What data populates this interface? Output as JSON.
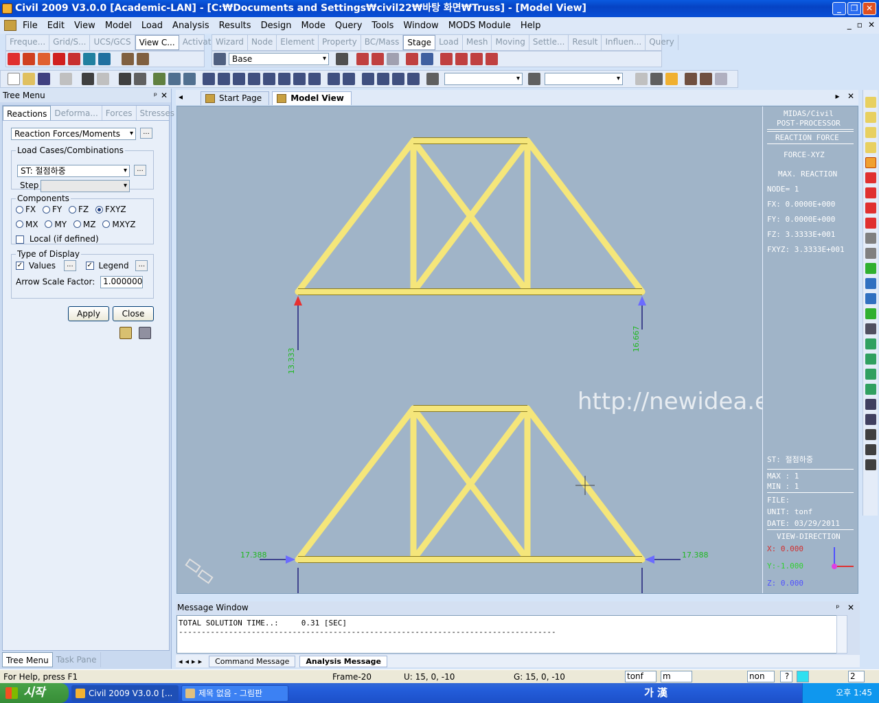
{
  "window": {
    "title": "Civil 2009 V3.0.0 [Academic-LAN] - [C:₩Documents and Settings₩civil22₩바탕 화면₩Truss] - [Model View]",
    "buttons": [
      "_",
      "❐",
      "✕"
    ]
  },
  "menu": {
    "items": [
      "File",
      "Edit",
      "View",
      "Model",
      "Load",
      "Analysis",
      "Results",
      "Design",
      "Mode",
      "Query",
      "Tools",
      "Window",
      "MODS Module",
      "Help"
    ],
    "mdi_controls": [
      "_",
      "▫",
      "✕"
    ]
  },
  "toolbar_left_tabs": [
    "Freque...",
    "Grid/S...",
    "UCS/GCS",
    "View C...",
    "Activat..."
  ],
  "toolbar_left_active": 3,
  "toolbar_right_tabs": [
    "Wizard",
    "Node",
    "Element",
    "Property",
    "BC/Mass",
    "Stage",
    "Load",
    "Mesh",
    "Moving",
    "Settle...",
    "Result",
    "Influen...",
    "Query"
  ],
  "toolbar_right_active": 5,
  "stage_combo": "Base",
  "tree_menu": {
    "title": "Tree Menu",
    "pin": "ᵖ",
    "close": "✕",
    "tabs": [
      "Reactions",
      "Deforma...",
      "Forces",
      "Stresses"
    ],
    "active_tab": 0,
    "result_type": "Reaction Forces/Moments",
    "load_cases_label": "Load Cases/Combinations",
    "load_case": "ST: 절점하중",
    "step_label": "Step",
    "components_label": "Components",
    "components_row1": [
      "FX",
      "FY",
      "FZ",
      "FXYZ"
    ],
    "components_row2": [
      "MX",
      "MY",
      "MZ",
      "MXYZ"
    ],
    "selected_component": "FXYZ",
    "local_label": "Local (if defined)",
    "display_label": "Type of Display",
    "values_label": "Values",
    "legend_label": "Legend",
    "arrow_scale_label": "Arrow Scale Factor:",
    "arrow_scale_value": "1.000000",
    "apply": "Apply",
    "close_btn": "Close",
    "ellipsis": "...",
    "bottom_tabs": [
      "Tree Menu",
      "Task Pane"
    ],
    "bottom_active": 0
  },
  "doc_tabs": [
    "Start Page",
    "Model View"
  ],
  "doc_active": 1,
  "viewport": {
    "reactions_top": [
      "13.333",
      "16.667"
    ],
    "reactions_bottom": [
      "17.388",
      "17.388"
    ],
    "watermark": "http://newidea.egloos.com/"
  },
  "side_info": {
    "header1": "MIDAS/Civil",
    "header2": "POST-PROCESSOR",
    "result": "REACTION FORCE",
    "component": "FORCE-XYZ",
    "max_reaction": "MAX. REACTION",
    "node": "NODE= 1",
    "fx": "FX:   0.0000E+000",
    "fy": "FY:   0.0000E+000",
    "fz": "FZ:   3.3333E+001",
    "fxyz": "FXYZ: 3.3333E+001",
    "load_case": "ST: 절점하중",
    "max": "MAX : 1",
    "min": "MIN : 1",
    "file": "FILE:",
    "unit": "UNIT: tonf",
    "date": "DATE: 03/29/2011",
    "view_dir": "VIEW-DIRECTION",
    "vx": "X: 0.000",
    "vy": "Y:-1.000",
    "vz": "Z: 0.000",
    "colors": {
      "x": "#d23030",
      "y": "#30d030",
      "z": "#5050ff"
    }
  },
  "message_window": {
    "title": "Message Window",
    "line1": "TOTAL SOLUTION TIME..:     0.31 [SEC]",
    "line2": "-----------------------------------------------------------------------------------",
    "tabs": [
      "Command Message",
      "Analysis Message"
    ],
    "active_tab": 1
  },
  "status": {
    "help": "For Help, press F1",
    "frame": "Frame-20",
    "u": "U: 15, 0, -10",
    "g": "G: 15, 0, -10",
    "force_unit": "tonf",
    "length_unit": "m",
    "snap": "non",
    "page": "2"
  },
  "taskbar": {
    "start": "시작",
    "tasks": [
      "Civil 2009 V3.0.0 [...",
      "제목 없음 - 그림판"
    ],
    "ime": "가 漢",
    "clock": "오후 1:45"
  },
  "colors": {
    "member": "#f5e67a",
    "member_edge": "#8a7a20",
    "viewport_bg": "#a0b4c8",
    "support_arrow": "#6b6bff",
    "max_arrow": "#e83030",
    "value_text": "#1fb81f"
  }
}
